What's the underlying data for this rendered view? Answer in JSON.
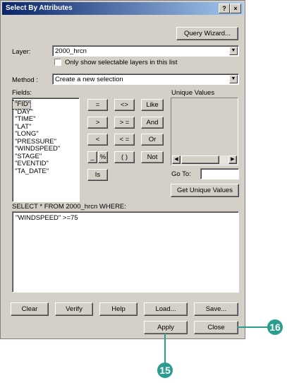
{
  "window": {
    "title": "Select By Attributes",
    "help_glyph": "?",
    "close_glyph": "×"
  },
  "query_wizard_label": "Query Wizard...",
  "layer": {
    "label": "Layer:",
    "value": "2000_hrcn",
    "checkbox_label": "Only show selectable layers in this list"
  },
  "method": {
    "label": "Method :",
    "value": "Create a new selection"
  },
  "fields": {
    "label": "Fields:",
    "items": [
      "\"FID\"",
      "\"DAY\"",
      "\"TIME\"",
      "\"LAT\"",
      "\"LONG\"",
      "\"PRESSURE\"",
      "\"WINDSPEED\"",
      "\"STAGE\"",
      "\"EVENTID\"",
      "\"TA_DATE\""
    ]
  },
  "operators": {
    "eq": "=",
    "ne": "<>",
    "like": "Like",
    "gt": ">",
    "ge": "> =",
    "and": "And",
    "lt": "<",
    "le": "< =",
    "or": "Or",
    "underscore": "_",
    "percent": "%",
    "parens": "( )",
    "not": "Not",
    "is": "Is"
  },
  "unique_values": {
    "label": "Unique Values",
    "goto_label": "Go To:",
    "get_button": "Get Unique Values"
  },
  "sql": {
    "label": "SELECT * FROM 2000_hrcn WHERE:",
    "expression": "\"WINDSPEED\" >=75"
  },
  "buttons": {
    "clear": "Clear",
    "verify": "Verify",
    "help": "Help",
    "load": "Load...",
    "save": "Save...",
    "apply": "Apply",
    "close": "Close"
  },
  "callouts": {
    "apply_step": "15",
    "close_step": "16"
  },
  "colors": {
    "titlebar_start": "#0a246a",
    "titlebar_end": "#a6caf0",
    "dialog_bg": "#d4d0c8",
    "callout": "#2a9d8f"
  }
}
